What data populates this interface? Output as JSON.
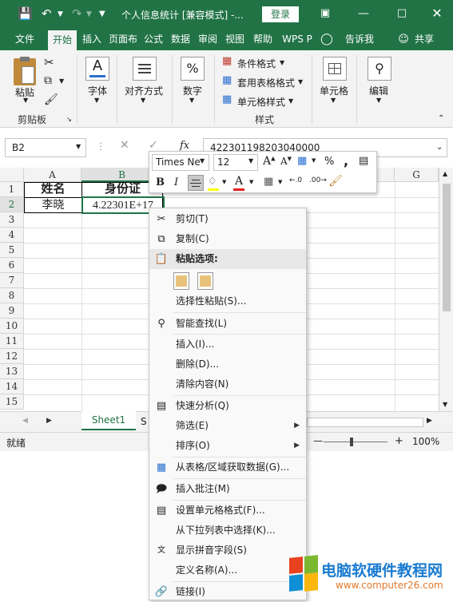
{
  "titlebar": {
    "title": "个人信息统计  [兼容模式]  -...",
    "login": "登录",
    "bg_color": "#217346"
  },
  "tabs": [
    "文件",
    "开始",
    "插入",
    "页面布",
    "公式",
    "数据",
    "审阅",
    "视图",
    "帮助",
    "WPS P",
    "告诉我",
    "共享"
  ],
  "ribbon": {
    "paste": "粘贴",
    "clipboard": "剪贴板",
    "font": "字体",
    "alignment": "对齐方式",
    "number": "数字",
    "conditional_format": "条件格式",
    "table_format": "套用表格格式",
    "cell_style": "单元格样式",
    "styles": "样式",
    "cells": "单元格",
    "editing": "编辑",
    "font_glyph": "A",
    "number_glyph": "%"
  },
  "formula_bar": {
    "name_box": "B2",
    "formula": "42230119820304000​0",
    "fx": "fx"
  },
  "grid": {
    "columns": [
      "A",
      "B",
      "G"
    ],
    "rows": [
      "1",
      "2",
      "3",
      "4",
      "5",
      "6",
      "7",
      "8",
      "9",
      "10",
      "11",
      "12",
      "13",
      "14",
      "15"
    ],
    "a1": "姓名",
    "b1": "身份证",
    "a2": "李晓",
    "b2": "4.22301E+17"
  },
  "sheet": {
    "tab": "Sheet1",
    "partial": "S"
  },
  "status": {
    "ready": "就绪",
    "zoom": "100%",
    "minus": "—",
    "plus": "+"
  },
  "mini_toolbar": {
    "font": "Times Ne",
    "size": "12",
    "bold": "B",
    "italic": "I",
    "percent": "%",
    "comma": ","
  },
  "context_menu": {
    "cut": "剪切(T)",
    "copy": "复制(C)",
    "paste_options": "粘贴选项:",
    "paste_special": "选择性粘贴(S)...",
    "smart_lookup": "智能查找(L)",
    "insert": "插入(I)...",
    "delete": "删除(D)...",
    "clear": "清除内容(N)",
    "quick_analysis": "快速分析(Q)",
    "filter": "筛选(E)",
    "sort": "排序(O)",
    "get_data": "从表格/区域获取数据(G)...",
    "insert_comment": "插入批注(M)",
    "format_cells": "设置单元格格式(F)...",
    "pick_list": "从下拉列表中选择(K)...",
    "phonetic": "显示拼音字段(S)",
    "define_name": "定义名称(A)...",
    "link": "链接(I)"
  },
  "watermark": {
    "text": "电脑软硬件教程网",
    "url": "www.computer26.com"
  }
}
